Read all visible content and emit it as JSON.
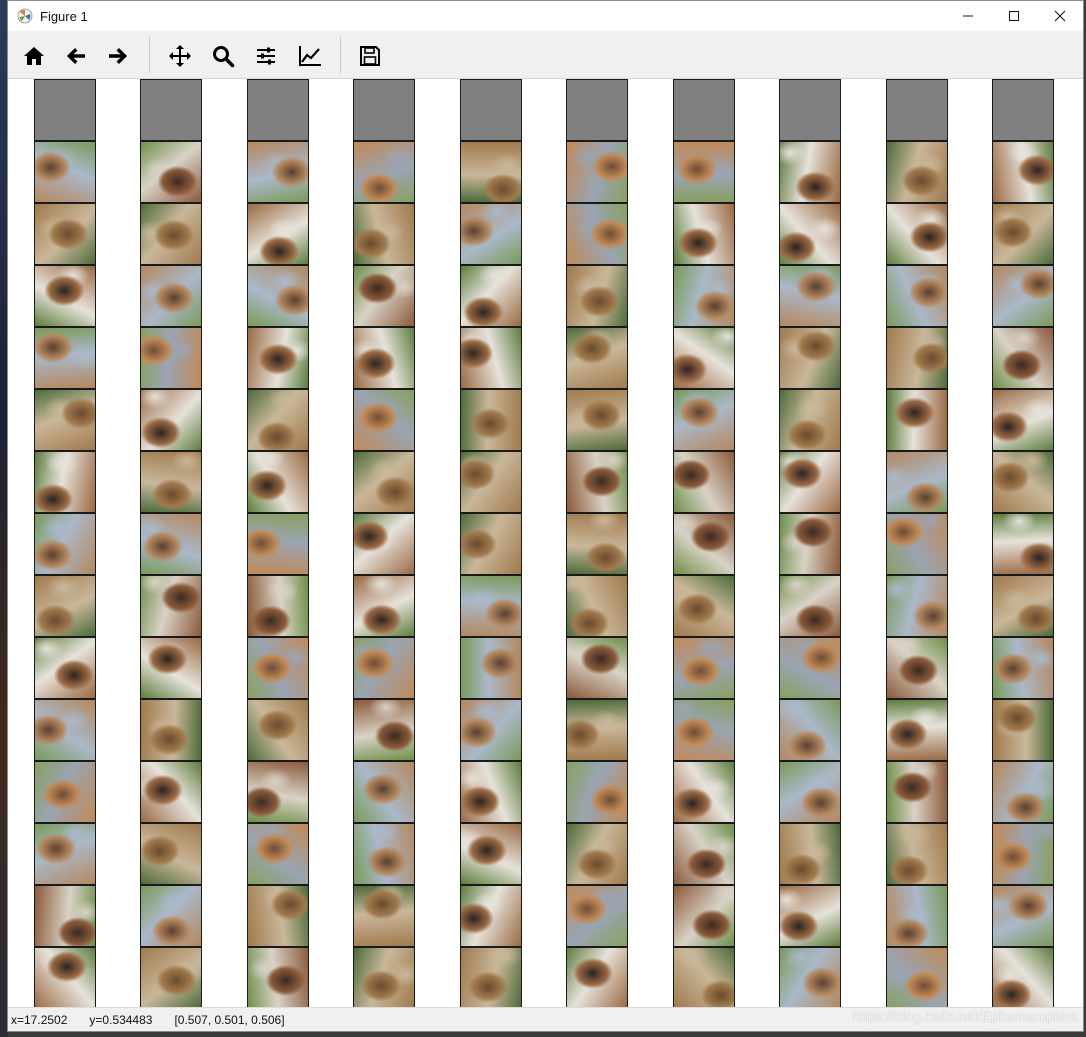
{
  "window": {
    "title": "Figure 1"
  },
  "titlebar_buttons": [
    "minimize",
    "maximize",
    "close"
  ],
  "toolbar": {
    "buttons": [
      "home-icon",
      "back-icon",
      "forward-icon",
      "pan-icon",
      "zoom-icon",
      "configure-subplots-icon",
      "edit-axes-icon",
      "save-icon"
    ]
  },
  "figure": {
    "grid_columns": 10,
    "grid_rows": 15,
    "first_row": "gray placeholder",
    "content": "generated horse images (GAN samples)"
  },
  "status": {
    "x": "x=17.2502",
    "y": "y=0.534483",
    "rgb": "[0.507, 0.501, 0.506]"
  },
  "watermark": "https://blog.csdn.net/Ephemeroptera"
}
